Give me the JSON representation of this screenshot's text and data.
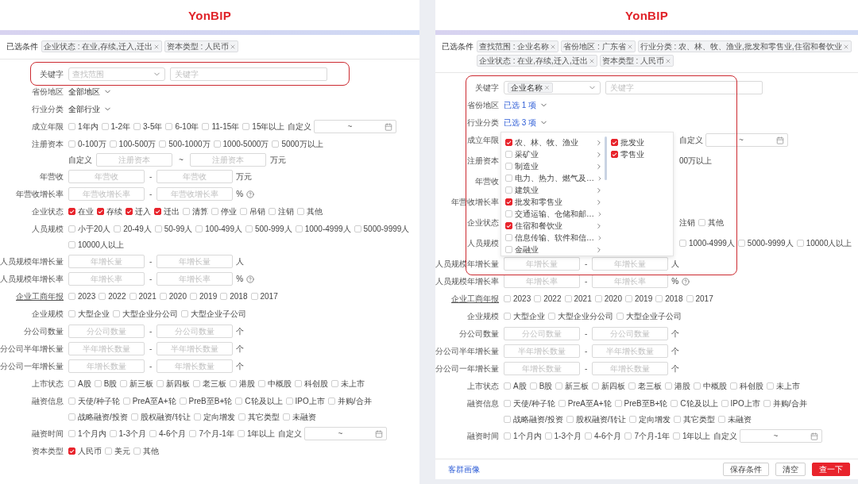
{
  "panels": [
    {
      "logo": "YonBIP",
      "filter_label": "已选条件",
      "tags": [
        {
          "text": "企业状态 : 在业,存续,迁入,迁出"
        },
        {
          "text": "资本类型 : 人民币"
        }
      ],
      "highlighted_rows": [
        {
          "kind": "keyword",
          "label": "关键字",
          "scope_placeholder": "查找范围",
          "placeholder": "关键字"
        }
      ],
      "rows": [
        {
          "kind": "picker",
          "label": "省份地区",
          "value": "全部地区",
          "active": false
        },
        {
          "kind": "picker",
          "label": "行业分类",
          "value": "全部行业",
          "active": false
        },
        {
          "kind": "checks",
          "label": "成立年限",
          "options": [
            {
              "label": "1年内",
              "checked": false
            },
            {
              "label": "1-2年",
              "checked": false
            },
            {
              "label": "3-5年",
              "checked": false
            },
            {
              "label": "6-10年",
              "checked": false
            },
            {
              "label": "11-15年",
              "checked": false
            },
            {
              "label": "15年以上",
              "checked": false
            }
          ],
          "custom": {
            "label": "自定义",
            "separator": "~"
          }
        },
        {
          "kind": "checks",
          "label": "注册资本",
          "options": [
            {
              "label": "0-100万",
              "checked": false
            },
            {
              "label": "100-500万",
              "checked": false
            },
            {
              "label": "500-1000万",
              "checked": false
            },
            {
              "label": "1000-5000万",
              "checked": false
            },
            {
              "label": "5000万以上",
              "checked": false
            }
          ],
          "custom_range": {
            "label": "自定义",
            "placeholders": [
              "注册资本",
              "注册资本"
            ],
            "separator": "~",
            "unit": "万元"
          }
        },
        {
          "kind": "range",
          "label": "年营收",
          "placeholders": [
            "年营收",
            "年营收"
          ],
          "separator": "-",
          "unit": "万元",
          "help": false
        },
        {
          "kind": "range",
          "label": "年营收增长率",
          "placeholders": [
            "年营收增长率",
            "年营收增长率"
          ],
          "separator": "-",
          "unit": "%",
          "help": true
        },
        {
          "kind": "checks",
          "label": "企业状态",
          "options": [
            {
              "label": "在业",
              "checked": true
            },
            {
              "label": "存续",
              "checked": true
            },
            {
              "label": "迁入",
              "checked": true
            },
            {
              "label": "迁出",
              "checked": true
            },
            {
              "label": "清算",
              "checked": false
            },
            {
              "label": "停业",
              "checked": false
            },
            {
              "label": "吊销",
              "checked": false
            },
            {
              "label": "注销",
              "checked": false
            },
            {
              "label": "其他",
              "checked": false
            }
          ]
        },
        {
          "kind": "checks",
          "label": "人员规模",
          "options": [
            {
              "label": "小于20人",
              "checked": false
            },
            {
              "label": "20-49人",
              "checked": false
            },
            {
              "label": "50-99人",
              "checked": false
            },
            {
              "label": "100-499人",
              "checked": false
            },
            {
              "label": "500-999人",
              "checked": false
            },
            {
              "label": "1000-4999人",
              "checked": false
            },
            {
              "label": "5000-9999人",
              "checked": false
            },
            {
              "label": "10000人以上",
              "checked": false
            }
          ]
        },
        {
          "kind": "range",
          "label": "人员规模年增长量",
          "placeholders": [
            "年增长量",
            "年增长量"
          ],
          "separator": "-",
          "unit": "人",
          "help": false
        },
        {
          "kind": "range",
          "label": "人员规模年增长率",
          "placeholders": [
            "年增长率",
            "年增长率"
          ],
          "separator": "-",
          "unit": "%",
          "help": true
        },
        {
          "kind": "checks",
          "label": "企业工商年报",
          "underlined": true,
          "options": [
            {
              "label": "2023",
              "checked": false
            },
            {
              "label": "2022",
              "checked": false
            },
            {
              "label": "2021",
              "checked": false
            },
            {
              "label": "2020",
              "checked": false
            },
            {
              "label": "2019",
              "checked": false
            },
            {
              "label": "2018",
              "checked": false
            },
            {
              "label": "2017",
              "checked": false
            }
          ]
        },
        {
          "kind": "checks",
          "label": "企业规模",
          "options": [
            {
              "label": "大型企业",
              "checked": false
            },
            {
              "label": "大型企业分公司",
              "checked": false
            },
            {
              "label": "大型企业子公司",
              "checked": false
            }
          ]
        },
        {
          "kind": "range",
          "label": "分公司数量",
          "placeholders": [
            "分公司数量",
            "分公司数量"
          ],
          "separator": "-",
          "unit": "个",
          "help": false
        },
        {
          "kind": "range",
          "label": "分公司半年增长量",
          "placeholders": [
            "半年增长数量",
            "半年增长数量"
          ],
          "separator": "-",
          "unit": "个",
          "help": false
        },
        {
          "kind": "range",
          "label": "分公司一年增长量",
          "placeholders": [
            "年增长数量",
            "年增长数量"
          ],
          "separator": "-",
          "unit": "个",
          "help": false
        },
        {
          "kind": "checks",
          "label": "上市状态",
          "options": [
            {
              "label": "A股",
              "checked": false
            },
            {
              "label": "B股",
              "checked": false
            },
            {
              "label": "新三板",
              "checked": false
            },
            {
              "label": "新四板",
              "checked": false
            },
            {
              "label": "老三板",
              "checked": false
            },
            {
              "label": "港股",
              "checked": false
            },
            {
              "label": "中概股",
              "checked": false
            },
            {
              "label": "科创股",
              "checked": false
            },
            {
              "label": "未上市",
              "checked": false
            }
          ]
        },
        {
          "kind": "checks",
          "label": "融资信息",
          "options": [
            {
              "label": "天使/种子轮",
              "checked": false
            },
            {
              "label": "PreA至A+轮",
              "checked": false
            },
            {
              "label": "PreB至B+轮",
              "checked": false
            },
            {
              "label": "C轮及以上",
              "checked": false
            },
            {
              "label": "IPO上市",
              "checked": false
            },
            {
              "label": "并购/合并",
              "checked": false
            },
            {
              "label": "战略融资/投资",
              "checked": false
            },
            {
              "label": "股权融资/转让",
              "checked": false
            },
            {
              "label": "定向增发",
              "checked": false
            },
            {
              "label": "其它类型",
              "checked": false
            },
            {
              "label": "未融资",
              "checked": false
            }
          ]
        },
        {
          "kind": "checks",
          "label": "融资时间",
          "options": [
            {
              "label": "1个月内",
              "checked": false
            },
            {
              "label": "1-3个月",
              "checked": false
            },
            {
              "label": "4-6个月",
              "checked": false
            },
            {
              "label": "7个月-1年",
              "checked": false
            },
            {
              "label": "1年以上",
              "checked": false
            }
          ],
          "custom": {
            "label": "自定义",
            "separator": "~"
          }
        },
        {
          "kind": "checks",
          "label": "资本类型",
          "options": [
            {
              "label": "人民币",
              "checked": true
            },
            {
              "label": "美元",
              "checked": false
            },
            {
              "label": "其他",
              "checked": false
            }
          ]
        }
      ]
    },
    {
      "logo": "YonBIP",
      "filter_label": "已选条件",
      "tags": [
        {
          "text": "查找范围 : 企业名称"
        },
        {
          "text": "省份地区 : 广东省"
        },
        {
          "text": "行业分类 : 农、林、牧、渔业,批发和零售业,住宿和餐饮业"
        },
        {
          "text": "企业状态 : 在业,存续,迁入,迁出"
        },
        {
          "text": "资本类型 : 人民币"
        }
      ],
      "highlighted_rows": [
        {
          "kind": "keyword",
          "label": "关键字",
          "scope_tags": [
            "企业名称"
          ],
          "placeholder": "关键字"
        },
        {
          "kind": "picker",
          "label": "省份地区",
          "value": "已选 1 项",
          "active": true
        },
        {
          "kind": "picker",
          "label": "行业分类",
          "value": "已选 3 项",
          "active": true,
          "popup": {
            "columns": [
              {
                "items": [
                  {
                    "label": "农、林、牧、渔业",
                    "checked": true,
                    "expandable": true
                  },
                  {
                    "label": "采矿业",
                    "checked": false,
                    "expandable": true
                  },
                  {
                    "label": "制造业",
                    "checked": false,
                    "expandable": true
                  },
                  {
                    "label": "电力、热力、燃气及…",
                    "checked": false,
                    "expandable": true
                  },
                  {
                    "label": "建筑业",
                    "checked": false,
                    "expandable": true
                  },
                  {
                    "label": "批发和零售业",
                    "checked": true,
                    "expandable": true
                  },
                  {
                    "label": "交通运输、仓储和邮…",
                    "checked": false,
                    "expandable": true
                  },
                  {
                    "label": "住宿和餐饮业",
                    "checked": true,
                    "expandable": true
                  },
                  {
                    "label": "信息传输、软件和信…",
                    "checked": false,
                    "expandable": true
                  },
                  {
                    "label": "金融业",
                    "checked": false,
                    "expandable": true
                  }
                ]
              },
              {
                "items": [
                  {
                    "label": "批发业",
                    "checked": true,
                    "expandable": false
                  },
                  {
                    "label": "零售业",
                    "checked": true,
                    "expandable": false
                  }
                ]
              }
            ]
          }
        },
        {
          "kind": "checks",
          "label": "成立年限",
          "covered": true,
          "custom": {
            "label": "自定义",
            "separator": "~"
          }
        },
        {
          "kind": "checks",
          "label": "注册资本",
          "covered": true,
          "options": [
            {
              "kind": "text",
              "label": "00万以上"
            }
          ]
        },
        {
          "kind": "checks",
          "label": "年营收",
          "covered": true
        },
        {
          "kind": "checks",
          "label": "年营收增长率",
          "covered": true
        },
        {
          "kind": "checks",
          "label": "企业状态",
          "covered": true,
          "options": [
            {
              "kind": "text",
              "label": "注销"
            },
            {
              "kind": "check",
              "label": "其他",
              "checked": false
            }
          ]
        },
        {
          "kind": "checks",
          "label": "人员规模",
          "covered": true,
          "options": [
            {
              "kind": "check",
              "label": "1000-4999人",
              "checked": false
            },
            {
              "kind": "check",
              "label": "5000-9999人",
              "checked": false
            },
            {
              "kind": "check",
              "label": "10000人以上",
              "checked": false
            }
          ]
        },
        {
          "kind": "range",
          "label": "人员规模年增长量",
          "placeholders": [
            "年增长量",
            "年增长量"
          ],
          "separator": "-",
          "unit": "人",
          "help": false
        }
      ],
      "rows": [
        {
          "kind": "range",
          "label": "人员规模年增长率",
          "placeholders": [
            "年增长率",
            "年增长率"
          ],
          "separator": "-",
          "unit": "%",
          "help": true
        },
        {
          "kind": "checks",
          "label": "企业工商年报",
          "underlined": true,
          "options": [
            {
              "label": "2023",
              "checked": false
            },
            {
              "label": "2022",
              "checked": false
            },
            {
              "label": "2021",
              "checked": false
            },
            {
              "label": "2020",
              "checked": false
            },
            {
              "label": "2019",
              "checked": false
            },
            {
              "label": "2018",
              "checked": false
            },
            {
              "label": "2017",
              "checked": false
            }
          ]
        },
        {
          "kind": "checks",
          "label": "企业规模",
          "options": [
            {
              "label": "大型企业",
              "checked": false
            },
            {
              "label": "大型企业分公司",
              "checked": false
            },
            {
              "label": "大型企业子公司",
              "checked": false
            }
          ]
        },
        {
          "kind": "range",
          "label": "分公司数量",
          "placeholders": [
            "分公司数量",
            "分公司数量"
          ],
          "separator": "-",
          "unit": "个",
          "help": false
        },
        {
          "kind": "range",
          "label": "分公司半年增长量",
          "placeholders": [
            "半年增长数量",
            "半年增长数量"
          ],
          "separator": "-",
          "unit": "个",
          "help": false
        },
        {
          "kind": "range",
          "label": "分公司一年增长量",
          "placeholders": [
            "年增长数量",
            "年增长数量"
          ],
          "separator": "-",
          "unit": "个",
          "help": false
        },
        {
          "kind": "checks",
          "label": "上市状态",
          "options": [
            {
              "label": "A股",
              "checked": false
            },
            {
              "label": "B股",
              "checked": false
            },
            {
              "label": "新三板",
              "checked": false
            },
            {
              "label": "新四板",
              "checked": false
            },
            {
              "label": "老三板",
              "checked": false
            },
            {
              "label": "港股",
              "checked": false
            },
            {
              "label": "中概股",
              "checked": false
            },
            {
              "label": "科创股",
              "checked": false
            },
            {
              "label": "未上市",
              "checked": false
            }
          ]
        },
        {
          "kind": "checks",
          "label": "融资信息",
          "options": [
            {
              "label": "天使/种子轮",
              "checked": false
            },
            {
              "label": "PreA至A+轮",
              "checked": false
            },
            {
              "label": "PreB至B+轮",
              "checked": false
            },
            {
              "label": "C轮及以上",
              "checked": false
            },
            {
              "label": "IPO上市",
              "checked": false
            },
            {
              "label": "并购/合并",
              "checked": false
            },
            {
              "label": "战略融资/投资",
              "checked": false
            },
            {
              "label": "股权融资/转让",
              "checked": false
            },
            {
              "label": "定向增发",
              "checked": false
            },
            {
              "label": "其它类型",
              "checked": false
            },
            {
              "label": "未融资",
              "checked": false
            }
          ]
        },
        {
          "kind": "checks",
          "label": "融资时间",
          "options": [
            {
              "label": "1个月内",
              "checked": false
            },
            {
              "label": "1-3个月",
              "checked": false
            },
            {
              "label": "4-6个月",
              "checked": false
            },
            {
              "label": "7个月-1年",
              "checked": false
            },
            {
              "label": "1年以上",
              "checked": false
            }
          ],
          "custom": {
            "label": "自定义",
            "separator": "~"
          }
        }
      ],
      "footer": {
        "link": "客群画像",
        "buttons": [
          {
            "label": "保存条件",
            "primary": false
          },
          {
            "label": "清空",
            "primary": false
          },
          {
            "label": "查一下",
            "primary": true
          }
        ]
      }
    }
  ]
}
